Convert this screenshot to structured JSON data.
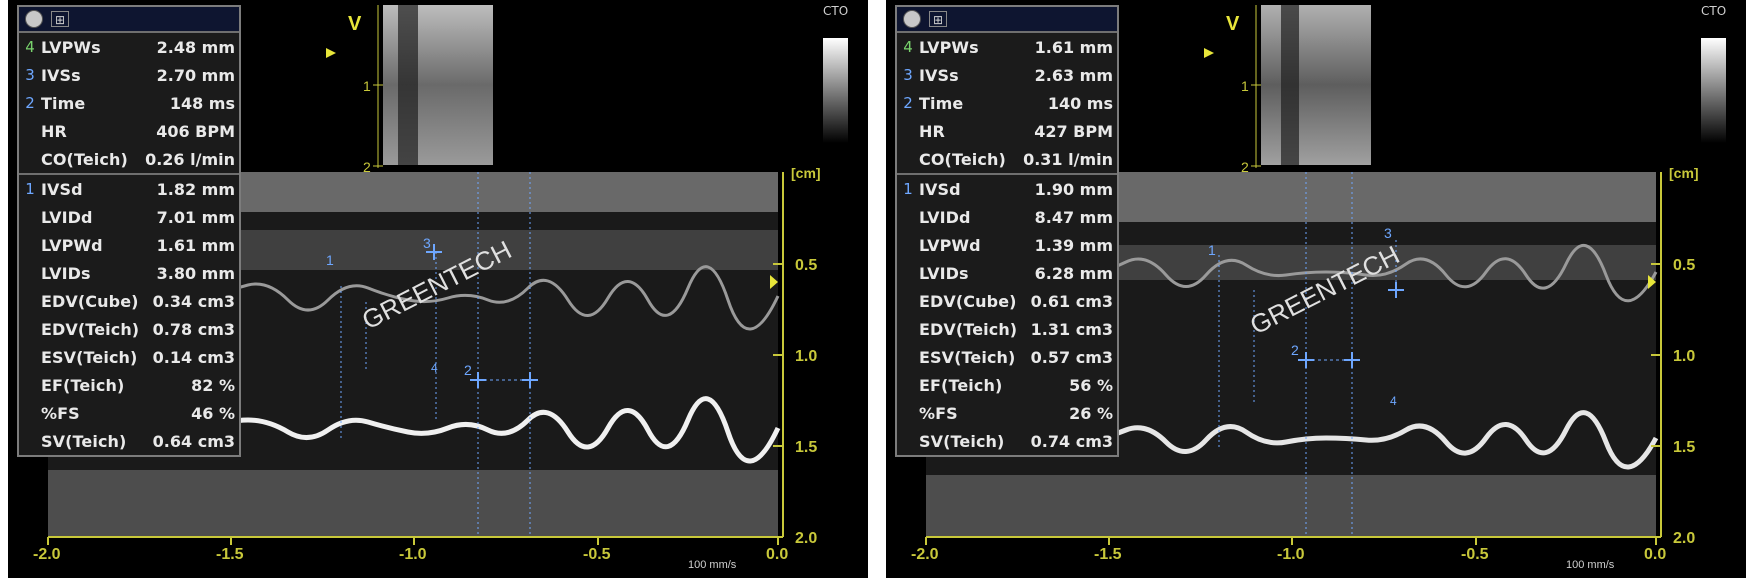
{
  "panels": [
    {
      "cto": "CTO",
      "scale_unit": "[cm]",
      "depth_ticks": [
        "0.5",
        "1.0",
        "1.5",
        "2.0"
      ],
      "time_ticks": [
        "-2.0",
        "-1.5",
        "-1.0",
        "-0.5",
        "0.0"
      ],
      "speed": "100 mm/s",
      "watermark": "GREENTECH",
      "vmode": {
        "marker": "V",
        "ticks": [
          "1",
          "2"
        ]
      },
      "groups": [
        [
          {
            "idx": "4",
            "label": "LVPWs",
            "value": "2.48 mm",
            "idx_color": "green"
          },
          {
            "idx": "3",
            "label": "IVSs",
            "value": "2.70 mm",
            "idx_color": "blue"
          },
          {
            "idx": "2",
            "label": "Time",
            "value": "148 ms",
            "idx_color": "blue"
          },
          {
            "idx": "",
            "label": "HR",
            "value": "406 BPM"
          },
          {
            "idx": "",
            "label": "CO(Teich)",
            "value": "0.26 l/min"
          }
        ],
        [
          {
            "idx": "1",
            "label": "IVSd",
            "value": "1.82 mm",
            "idx_color": "blue"
          },
          {
            "idx": "",
            "label": "LVIDd",
            "value": "7.01 mm"
          },
          {
            "idx": "",
            "label": "LVPWd",
            "value": "1.61 mm"
          },
          {
            "idx": "",
            "label": "LVIDs",
            "value": "3.80 mm"
          },
          {
            "idx": "",
            "label": "EDV(Cube)",
            "value": "0.34 cm3"
          },
          {
            "idx": "",
            "label": "EDV(Teich)",
            "value": "0.78 cm3"
          },
          {
            "idx": "",
            "label": "ESV(Teich)",
            "value": "0.14 cm3"
          },
          {
            "idx": "",
            "label": "EF(Teich)",
            "value": "82 %"
          },
          {
            "idx": "",
            "label": "%FS",
            "value": "46 %"
          },
          {
            "idx": "",
            "label": "SV(Teich)",
            "value": "0.64 cm3"
          }
        ]
      ],
      "caliper_labels": [
        "1",
        "2",
        "3",
        "4"
      ]
    },
    {
      "cto": "CTO",
      "scale_unit": "[cm]",
      "depth_ticks": [
        "0.5",
        "1.0",
        "1.5",
        "2.0"
      ],
      "time_ticks": [
        "-2.0",
        "-1.5",
        "-1.0",
        "-0.5",
        "0.0"
      ],
      "speed": "100 mm/s",
      "watermark": "GREENTECH",
      "vmode": {
        "marker": "V",
        "ticks": [
          "1",
          "2"
        ]
      },
      "groups": [
        [
          {
            "idx": "4",
            "label": "LVPWs",
            "value": "1.61 mm",
            "idx_color": "green"
          },
          {
            "idx": "3",
            "label": "IVSs",
            "value": "2.63 mm",
            "idx_color": "blue"
          },
          {
            "idx": "2",
            "label": "Time",
            "value": "140 ms",
            "idx_color": "blue"
          },
          {
            "idx": "",
            "label": "HR",
            "value": "427 BPM"
          },
          {
            "idx": "",
            "label": "CO(Teich)",
            "value": "0.31 l/min"
          }
        ],
        [
          {
            "idx": "1",
            "label": "IVSd",
            "value": "1.90 mm",
            "idx_color": "blue"
          },
          {
            "idx": "",
            "label": "LVIDd",
            "value": "8.47 mm"
          },
          {
            "idx": "",
            "label": "LVPWd",
            "value": "1.39 mm"
          },
          {
            "idx": "",
            "label": "LVIDs",
            "value": "6.28 mm"
          },
          {
            "idx": "",
            "label": "EDV(Cube)",
            "value": "0.61 cm3"
          },
          {
            "idx": "",
            "label": "EDV(Teich)",
            "value": "1.31 cm3"
          },
          {
            "idx": "",
            "label": "ESV(Teich)",
            "value": "0.57 cm3"
          },
          {
            "idx": "",
            "label": "EF(Teich)",
            "value": "56 %"
          },
          {
            "idx": "",
            "label": "%FS",
            "value": "26 %"
          },
          {
            "idx": "",
            "label": "SV(Teich)",
            "value": "0.74 cm3"
          }
        ]
      ],
      "caliper_labels": [
        "1",
        "2",
        "3",
        "4"
      ]
    }
  ],
  "colors": {
    "scale": "#c8c83a",
    "caliper": "#6ea7ff",
    "panel_bg": "#000000",
    "text": "#e9e9e9"
  }
}
